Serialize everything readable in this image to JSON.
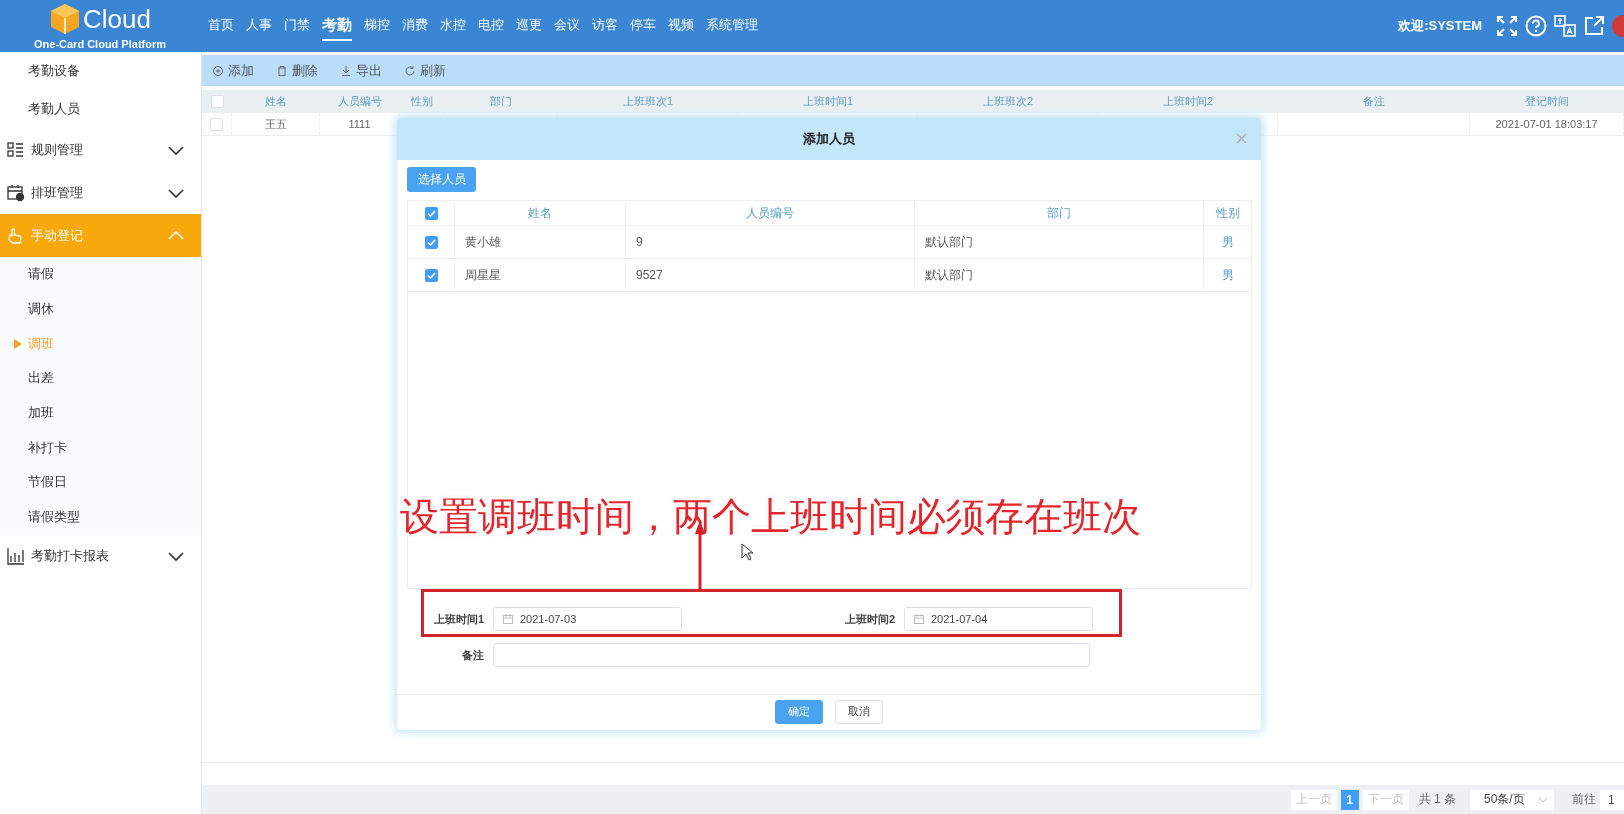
{
  "header": {
    "logo_text": "Cloud",
    "logo_subtitle": "One-Card Cloud Platform",
    "nav": [
      {
        "label": "首页",
        "selected": false
      },
      {
        "label": "人事",
        "selected": false
      },
      {
        "label": "门禁",
        "selected": false
      },
      {
        "label": "考勤",
        "selected": true
      },
      {
        "label": "梯控",
        "selected": false
      },
      {
        "label": "消费",
        "selected": false
      },
      {
        "label": "水控",
        "selected": false
      },
      {
        "label": "电控",
        "selected": false
      },
      {
        "label": "巡更",
        "selected": false
      },
      {
        "label": "会议",
        "selected": false
      },
      {
        "label": "访客",
        "selected": false
      },
      {
        "label": "停车",
        "selected": false
      },
      {
        "label": "视频",
        "selected": false
      },
      {
        "label": "系统管理",
        "selected": false
      }
    ],
    "welcome": "欢迎:SYSTEM"
  },
  "sidebar": {
    "items": [
      {
        "kind": "link",
        "label": "考勤设备"
      },
      {
        "kind": "link",
        "label": "考勤人员"
      },
      {
        "kind": "group",
        "label": "规则管理",
        "expanded": false,
        "selected": false
      },
      {
        "kind": "group",
        "label": "排班管理",
        "expanded": false,
        "selected": false
      },
      {
        "kind": "group",
        "label": "手动登记",
        "expanded": true,
        "selected": true,
        "children": [
          {
            "label": "请假",
            "selected": false
          },
          {
            "label": "调休",
            "selected": false
          },
          {
            "label": "调班",
            "selected": true
          },
          {
            "label": "出差",
            "selected": false
          },
          {
            "label": "加班",
            "selected": false
          },
          {
            "label": "补打卡",
            "selected": false
          },
          {
            "label": "节假日",
            "selected": false
          },
          {
            "label": "请假类型",
            "selected": false
          }
        ]
      },
      {
        "kind": "group",
        "label": "考勤打卡报表",
        "expanded": false,
        "selected": false
      }
    ]
  },
  "toolbar": {
    "buttons": [
      "添加",
      "删除",
      "导出",
      "刷新"
    ]
  },
  "table": {
    "select_all": {
      "checked": false
    },
    "columns": [
      "姓名",
      "人员编号",
      "性别",
      "部门",
      "上班班次1",
      "上班时间1",
      "上班班次2",
      "上班时间2",
      "备注",
      "登记时间"
    ],
    "rows": [
      {
        "checked": false,
        "name": "王五",
        "number": "1111",
        "registered": "2021-07-01 18:03:17"
      }
    ]
  },
  "pagination": {
    "prev": "上一页",
    "pages": [
      {
        "label": "1",
        "selected": true
      }
    ],
    "next": "下一页",
    "total": "共 1 条",
    "page_size": "50条/页",
    "goto_label": "前往",
    "goto_value": "1"
  },
  "dialog": {
    "title": "添加人员",
    "select_button": "选择人员",
    "table": {
      "select_all": {
        "checked": true
      },
      "columns": [
        "姓名",
        "人员编号",
        "部门",
        "性别"
      ],
      "rows": [
        {
          "checked": true,
          "cells": [
            "黄小雄",
            "9",
            "默认部门",
            "男"
          ]
        },
        {
          "checked": true,
          "cells": [
            "周星星",
            "9527",
            "默认部门",
            "男"
          ]
        }
      ]
    },
    "fields": [
      {
        "label": "上班时间1",
        "value": "2021-07-03"
      },
      {
        "label": "上班时间2",
        "value": "2021-07-04"
      }
    ],
    "remark": {
      "label": "备注"
    },
    "buttons": [
      {
        "label": "确定",
        "primary": true
      },
      {
        "label": "取消",
        "primary": false
      }
    ]
  },
  "annotation": {
    "text": "设置调班时间，两个上班时间必须存在班次"
  }
}
